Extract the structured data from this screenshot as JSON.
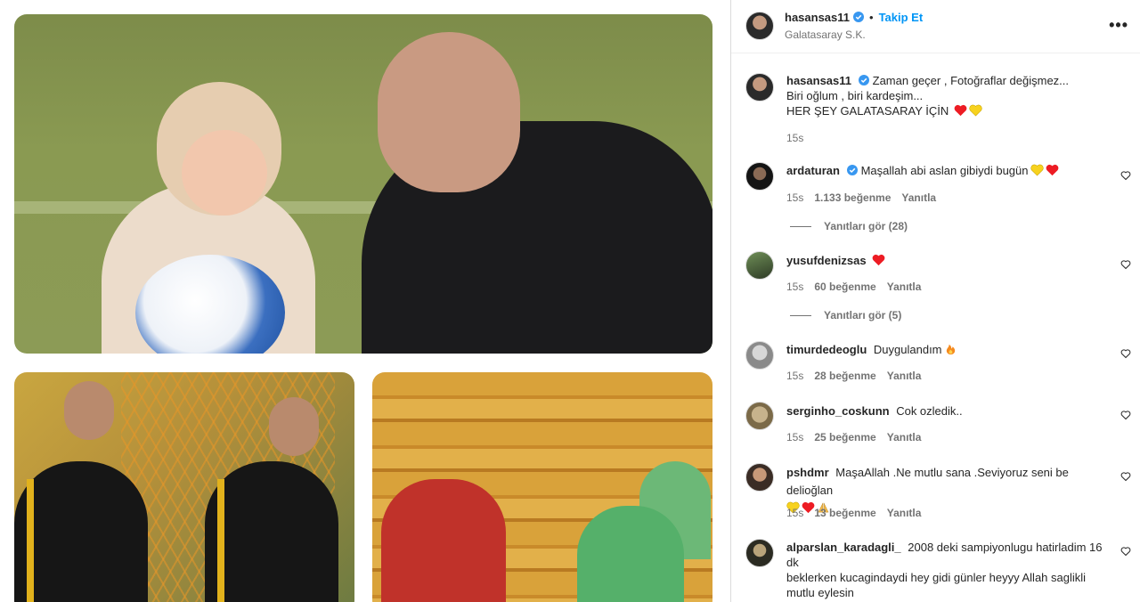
{
  "header": {
    "username": "hasansas11",
    "follow_label": "Takip Et",
    "subtitle": "Galatasaray S.K."
  },
  "caption": {
    "username": "hasansas11",
    "line1": "Zaman geçer , Fotoğraflar değişmez...",
    "line2": "Biri oğlum , biri kardeşim...",
    "line3": "HER ŞEY GALATASARAY İÇİN",
    "time": "15s"
  },
  "comments": [
    {
      "username": "ardaturan",
      "text": "Maşallah abi aslan gibiydi bugün",
      "time": "15s",
      "likes": "1.133 beğenme",
      "reply": "Yanıtla",
      "replies": "Yanıtları gör (28)"
    },
    {
      "username": "yusufdenizsas",
      "text": "",
      "time": "15s",
      "likes": "60 beğenme",
      "reply": "Yanıtla",
      "replies": "Yanıtları gör (5)"
    },
    {
      "username": "timurdedeoglu",
      "text": "Duygulandım",
      "time": "15s",
      "likes": "28 beğenme",
      "reply": "Yanıtla"
    },
    {
      "username": "serginho_coskunn",
      "text": "Cok ozledik..",
      "time": "15s",
      "likes": "25 beğenme",
      "reply": "Yanıtla"
    },
    {
      "username": "pshdmr",
      "text": "MaşaAllah .Ne mutlu sana .Seviyoruz seni be delioğlan",
      "time": "15s",
      "likes": "13 beğenme",
      "reply": "Yanıtla"
    },
    {
      "username": "alparslan_karadagli_",
      "text": "2008 deki sampiyonlugu hatirladim 16 dk",
      "text2": "beklerken kucagindaydi hey gidi günler heyyy Allah saglikli",
      "text3": "mutlu eylesin"
    }
  ],
  "colors": {
    "accent": "#0095f6",
    "verified": "#3897f0",
    "red_heart": "#ed1c24",
    "yellow_heart": "#f7d21e"
  }
}
